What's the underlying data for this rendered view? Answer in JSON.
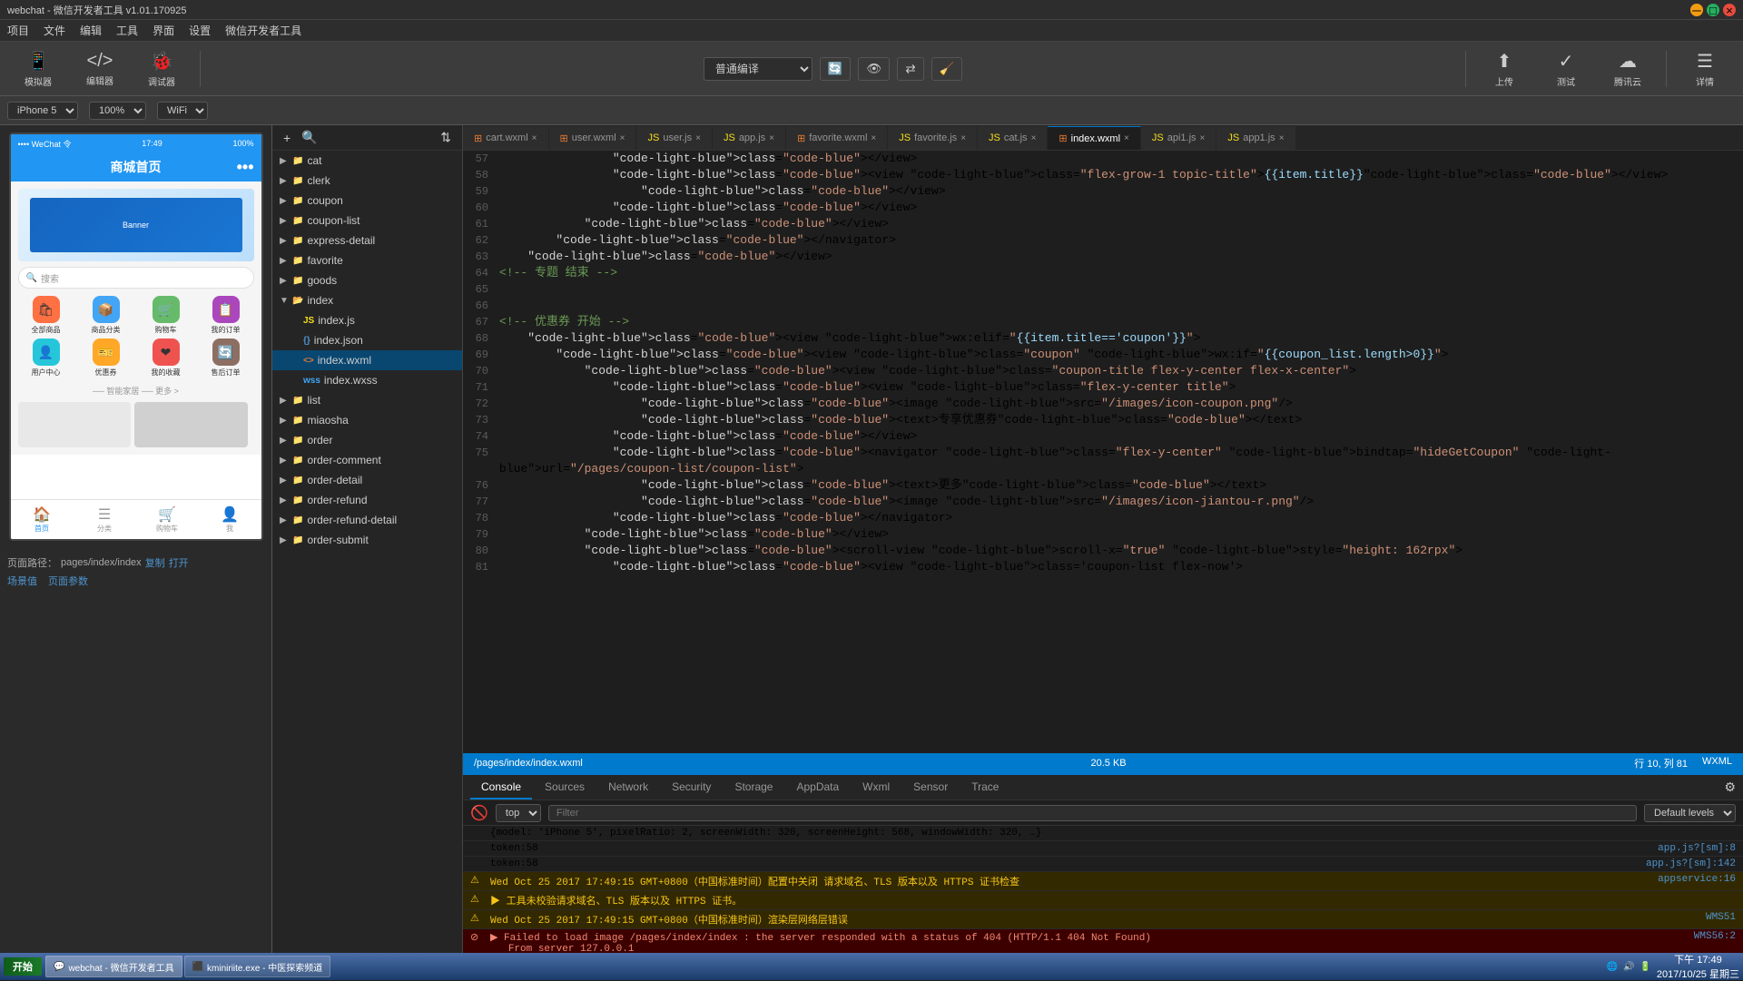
{
  "titlebar": {
    "title": "webchat - 微信开发者工具 v1.01.170925",
    "close_label": "×",
    "min_label": "─",
    "max_label": "□"
  },
  "menubar": {
    "items": [
      "项目",
      "文件",
      "编辑",
      "工具",
      "界面",
      "设置",
      "微信开发者工具"
    ]
  },
  "toolbar": {
    "simulator_label": "模拟器",
    "editor_label": "编辑器",
    "debugger_label": "调试器",
    "compile_label": "普通编译",
    "preview_label": "预览",
    "switch_label": "切换台",
    "clear_label": "清缓存",
    "upload_label": "上传",
    "test_label": "测试",
    "cloud_label": "腾讯云",
    "more_label": "详情"
  },
  "device_bar": {
    "phone_model": "iPhone 5",
    "zoom": "100%",
    "network": "WiFi"
  },
  "phone": {
    "status": "•••• WeChat 令",
    "time": "17:49",
    "battery": "100%",
    "header_title": "商城首页",
    "search_placeholder": "搜索",
    "icons": [
      {
        "label": "全部商品",
        "color": "#FF7043",
        "icon": "🛍"
      },
      {
        "label": "商品分类",
        "color": "#42A5F5",
        "icon": "📦"
      },
      {
        "label": "购物车",
        "color": "#66BB6A",
        "icon": "🛒"
      },
      {
        "label": "我的订单",
        "color": "#AB47BC",
        "icon": "📋"
      },
      {
        "label": "用户中心",
        "color": "#26C6DA",
        "icon": "👤"
      },
      {
        "label": "优惠券",
        "color": "#FFA726",
        "icon": "🎫"
      },
      {
        "label": "我的收藏",
        "color": "#EF5350",
        "icon": "❤"
      },
      {
        "label": "售后订单",
        "color": "#8D6E63",
        "icon": "🔄"
      }
    ],
    "divider": "── 智能家居 ──  更多 >",
    "tabs": [
      {
        "label": "首页",
        "icon": "🏠",
        "active": true
      },
      {
        "label": "分类",
        "icon": "☰",
        "active": false
      },
      {
        "label": "购物车",
        "icon": "🛒",
        "active": false
      },
      {
        "label": "我",
        "icon": "👤",
        "active": false
      }
    ],
    "path_label": "页面路径：",
    "path": "pages/index/index",
    "copy_label": "复制",
    "open_label": "打开",
    "scene_label": "场景值",
    "page_params_label": "页面参数"
  },
  "filetree": {
    "items": [
      {
        "name": "cat",
        "type": "folder",
        "indent": 1,
        "expanded": false
      },
      {
        "name": "clerk",
        "type": "folder",
        "indent": 1,
        "expanded": false
      },
      {
        "name": "coupon",
        "type": "folder",
        "indent": 1,
        "expanded": false
      },
      {
        "name": "coupon-list",
        "type": "folder",
        "indent": 1,
        "expanded": false
      },
      {
        "name": "express-detail",
        "type": "folder",
        "indent": 1,
        "expanded": false
      },
      {
        "name": "favorite",
        "type": "folder",
        "indent": 1,
        "expanded": false
      },
      {
        "name": "goods",
        "type": "folder",
        "indent": 1,
        "expanded": false
      },
      {
        "name": "index",
        "type": "folder",
        "indent": 1,
        "expanded": true
      },
      {
        "name": "index.js",
        "type": "js",
        "indent": 2,
        "expanded": false
      },
      {
        "name": "index.json",
        "type": "json",
        "indent": 2,
        "expanded": false
      },
      {
        "name": "index.wxml",
        "type": "wxml",
        "indent": 2,
        "expanded": false,
        "selected": true
      },
      {
        "name": "index.wxss",
        "type": "wxss",
        "indent": 2,
        "expanded": false
      },
      {
        "name": "list",
        "type": "folder",
        "indent": 1,
        "expanded": false
      },
      {
        "name": "miaosha",
        "type": "folder",
        "indent": 1,
        "expanded": false
      },
      {
        "name": "order",
        "type": "folder",
        "indent": 1,
        "expanded": false
      },
      {
        "name": "order-comment",
        "type": "folder",
        "indent": 1,
        "expanded": false
      },
      {
        "name": "order-detail",
        "type": "folder",
        "indent": 1,
        "expanded": false
      },
      {
        "name": "order-refund",
        "type": "folder",
        "indent": 1,
        "expanded": false
      },
      {
        "name": "order-refund-detail",
        "type": "folder",
        "indent": 1,
        "expanded": false
      },
      {
        "name": "order-submit",
        "type": "folder",
        "indent": 1,
        "expanded": false
      }
    ]
  },
  "editor_tabs": [
    {
      "name": "cart.wxml",
      "active": false
    },
    {
      "name": "user.wxml",
      "active": false
    },
    {
      "name": "user.js",
      "active": false
    },
    {
      "name": "app.js",
      "active": false
    },
    {
      "name": "favorite.wxml",
      "active": false
    },
    {
      "name": "favorite.js",
      "active": false
    },
    {
      "name": "cat.js",
      "active": false
    },
    {
      "name": "index.wxml",
      "active": true
    },
    {
      "name": "api1.js",
      "active": false
    },
    {
      "name": "app1.js",
      "active": false
    }
  ],
  "code_lines": [
    {
      "num": 57,
      "content": "                </view>"
    },
    {
      "num": 58,
      "content": "                <view class=\"flex-grow-1 topic-title\">{{item.title}}</view>"
    },
    {
      "num": 59,
      "content": "                    </view>"
    },
    {
      "num": 60,
      "content": "                </view>"
    },
    {
      "num": 61,
      "content": "            </view>"
    },
    {
      "num": 62,
      "content": "        </navigator>"
    },
    {
      "num": 63,
      "content": "    </view>"
    },
    {
      "num": 64,
      "content": "<!-- 专题 结束 -->"
    },
    {
      "num": 65,
      "content": ""
    },
    {
      "num": 66,
      "content": ""
    },
    {
      "num": 67,
      "content": "<!-- 优惠券 开始 -->"
    },
    {
      "num": 68,
      "content": "    <view wx:elif=\"{{item.title=='coupon'}}\">"
    },
    {
      "num": 69,
      "content": "        <view class=\"coupon\" wx:if=\"{{coupon_list.length>0}}\">"
    },
    {
      "num": 70,
      "content": "            <view class=\"coupon-title flex-y-center flex-x-center\">"
    },
    {
      "num": 71,
      "content": "                <view class=\"flex-y-center title\">"
    },
    {
      "num": 72,
      "content": "                    <image src=\"/images/icon-coupon.png\"/>"
    },
    {
      "num": 73,
      "content": "                    <text>专享优惠券</text>"
    },
    {
      "num": 74,
      "content": "                </view>"
    },
    {
      "num": 75,
      "content": "                <navigator class=\"flex-y-center\" bindtap=\"hideGetCoupon\" url=\"/pages/coupon-list/coupon-list\">"
    },
    {
      "num": 76,
      "content": "                    <text>更多</text>"
    },
    {
      "num": 77,
      "content": "                    <image src=\"/images/icon-jiantou-r.png\"/>"
    },
    {
      "num": 78,
      "content": "                </navigator>"
    },
    {
      "num": 79,
      "content": "            </view>"
    },
    {
      "num": 80,
      "content": "            <scroll-view scroll-x=\"true\" style=\"height: 162rpx\">"
    },
    {
      "num": 81,
      "content": "                <view class='coupon-list flex-now'>"
    }
  ],
  "editor_statusbar": {
    "path": "/pages/index/index.wxml",
    "size": "20.5 KB",
    "position": "行 10, 列 81",
    "format": "WXML"
  },
  "devtools": {
    "tabs": [
      "Console",
      "Sources",
      "Network",
      "Security",
      "Storage",
      "AppData",
      "Wxml",
      "Sensor",
      "Trace"
    ],
    "active_tab": "Console",
    "toolbar": {
      "context": "top",
      "filter_placeholder": "Filter",
      "level": "Default levels"
    },
    "console_lines": [
      {
        "type": "info",
        "text": "{model: 'iPhone 5', pixelRatio: 2, screenWidth: 320, screenHeight: 568, windowWidth: 320, …}",
        "source": ""
      },
      {
        "type": "info",
        "text": "token:58",
        "source": "app.js?[sm]:8"
      },
      {
        "type": "info",
        "text": "token:58",
        "source": "app.js?[sm]:142"
      },
      {
        "type": "warning",
        "text": "Wed Oct 25 2017 17:49:15 GMT+0800（中国标准时间）配置中关闭 请求域名、TLS 版本以及 HTTPS 证书检查",
        "source": "appservice:16"
      },
      {
        "type": "warning",
        "text": "▶ 工具未校验请求域名、TLS 版本以及 HTTPS 证书。",
        "source": ""
      },
      {
        "type": "warning",
        "text": "Wed Oct 25 2017 17:49:15 GMT+0800（中国标准时间）渲染层网络层错误",
        "source": "WMS51"
      },
      {
        "type": "error",
        "text": "▶ Failed to load image /pages/index/index : the server responded with a status of 404 (HTTP/1.1 404 Not Found)\n   From server 127.0.0.1",
        "source": "WMS56:2"
      }
    ],
    "input_prompt": ">"
  },
  "statusbar": {
    "path_label": "页面路径：",
    "path": "pages/index/index",
    "copy_label": "复制",
    "open_label": "打开",
    "scene_label": "场景值",
    "page_params_label": "页面参数"
  },
  "taskbar": {
    "start_label": "开始",
    "apps": [
      {
        "label": "webchat - 微信开发者工具",
        "active": true
      },
      {
        "label": "kminiriite.exe - 中医探索频道",
        "active": false
      }
    ],
    "time": "下午 17:49",
    "date": "2017/10/25 星期三"
  }
}
